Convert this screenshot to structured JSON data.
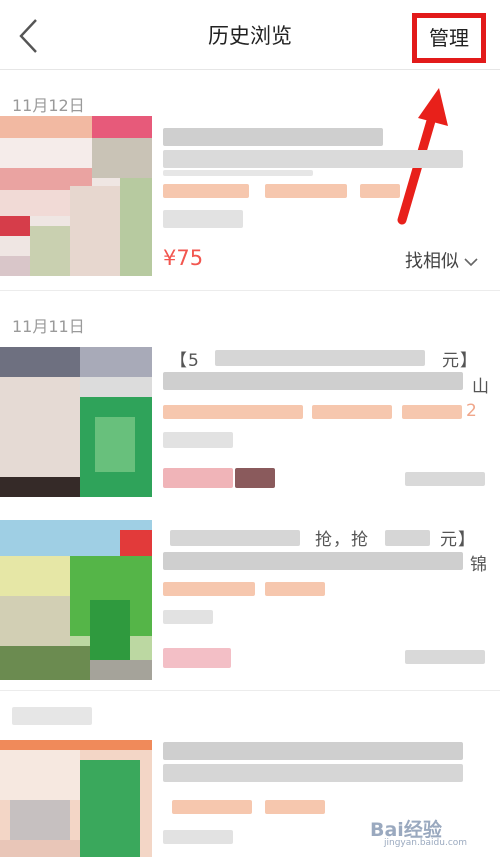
{
  "header": {
    "title": "历史浏览",
    "manage_label": "管理"
  },
  "groups": [
    {
      "date": "11月12日",
      "items": [
        {
          "snippet": "",
          "price": "¥75",
          "similar_label": "找相似"
        }
      ]
    },
    {
      "date": "11月11日",
      "items": [
        {
          "snippet_start": "【5",
          "snippet_end": "元】",
          "snippet_tail": "山",
          "tag_tail": "2"
        },
        {
          "snippet_mid": "抢，抢",
          "snippet_end": "元】",
          "snippet_tail": "锦"
        },
        {
          "snippet_mid": ""
        }
      ]
    }
  ],
  "watermark": {
    "text": "Bai经验",
    "url": "jingyan.baidu.com"
  },
  "colors": {
    "accent": "#f2564f",
    "highlight_box": "#e21a1a",
    "tag": "#f6c7ae"
  },
  "icons": [
    "back-chevron-icon",
    "chevron-down-icon",
    "red-arrow-annotation"
  ]
}
